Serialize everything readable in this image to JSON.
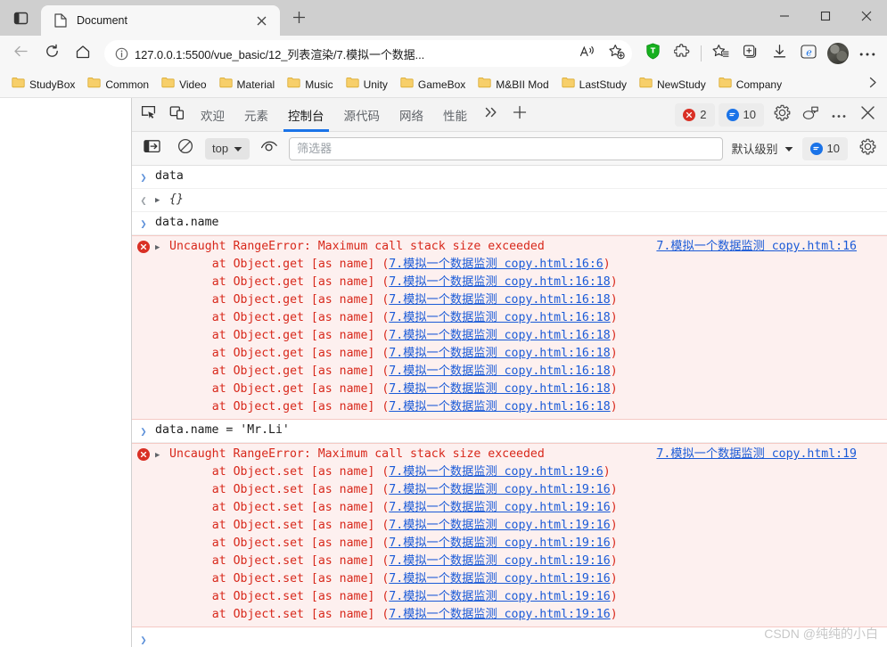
{
  "browser": {
    "tab": {
      "title": "Document",
      "favicon_icon": "page-icon",
      "close_icon": "close-icon"
    },
    "tabsearch_icon": "tab-search-icon",
    "newtab_icon": "plus-icon",
    "window_controls": {
      "minimize": "minimize-icon",
      "maximize": "maximize-icon",
      "close": "window-close-icon"
    },
    "nav": {
      "back_icon": "back-arrow-icon",
      "reload_icon": "reload-icon",
      "home_icon": "home-icon"
    },
    "omnibox": {
      "info_icon": "site-info-icon",
      "url_prefix": "127.0.0.1:5500",
      "url_rest": "/vue_basic/12_列表渲染/7.模拟一个数据...",
      "url_full": "127.0.0.1:5500/vue_basic/12_列表渲染/7.模拟一个数据...",
      "read_aloud_icon": "read-aloud-icon",
      "add_favorite_icon": "add-favorite-icon"
    },
    "toolbar_icons": [
      "green-shield-icon",
      "extensions-puzzle-icon",
      "favorites-icon",
      "collections-icon",
      "downloads-icon",
      "ie-mode-icon",
      "profile-avatar",
      "settings-more-icon"
    ],
    "bookmarks": [
      {
        "label": "StudyBox"
      },
      {
        "label": "Common"
      },
      {
        "label": "Video"
      },
      {
        "label": "Material"
      },
      {
        "label": "Music"
      },
      {
        "label": "Unity"
      },
      {
        "label": "GameBox"
      },
      {
        "label": "M&BII Mod"
      },
      {
        "label": "LastStudy"
      },
      {
        "label": "NewStudy"
      },
      {
        "label": "Company"
      }
    ],
    "bookmarks_overflow_icon": "chevron-right-icon"
  },
  "devtools": {
    "inspect_icon": "inspect-element-icon",
    "device_toolbar_icon": "device-toolbar-icon",
    "tabs": [
      {
        "label": "欢迎",
        "active": false
      },
      {
        "label": "元素",
        "active": false
      },
      {
        "label": "控制台",
        "active": true
      },
      {
        "label": "源代码",
        "active": false
      },
      {
        "label": "网络",
        "active": false
      },
      {
        "label": "性能",
        "active": false
      }
    ],
    "more_tabs_icon": "chevron-double-right-icon",
    "add_tab_icon": "plus-icon",
    "error_badge": {
      "count": "2",
      "icon": "error-circle-icon"
    },
    "message_badge": {
      "count": "10",
      "icon": "message-circle-icon"
    },
    "settings_icon": "gear-icon",
    "customize_icon": "devtools-dock-icon",
    "more_options_icon": "more-vertical-icon",
    "close_icon": "close-icon",
    "filterbar": {
      "sidebar_icon": "console-sidebar-icon",
      "clear_icon": "clear-console-icon",
      "context": "top",
      "context_chevron_icon": "chevron-down-icon",
      "eye_icon": "live-expression-eye-icon",
      "filter_placeholder": "筛选器",
      "filter_value": "",
      "level": "默认级别",
      "level_chevron_icon": "chevron-down-icon",
      "message_badge": {
        "count": "10",
        "icon": "message-circle-icon"
      },
      "settings_icon": "gear-icon"
    },
    "console_rows": [
      {
        "kind": "input",
        "prompt_icon": "chevron-right-icon",
        "text": "data"
      },
      {
        "kind": "output",
        "prompt_icon": "chevron-left-icon",
        "expander_icon": "triangle-right-icon",
        "text": "{}"
      },
      {
        "kind": "input",
        "prompt_icon": "chevron-right-icon",
        "text": "data.name"
      },
      {
        "kind": "error",
        "icon": "error-circle-icon",
        "expander_icon": "triangle-right-icon",
        "title": "Uncaught RangeError: Maximum call stack size exceeded",
        "source_link": "7.模拟一个数据监测 copy.html:16",
        "stack": [
          {
            "fn": "    at Object.get [as name] ",
            "link": "7.模拟一个数据监测 copy.html:16:6"
          },
          {
            "fn": "    at Object.get [as name] ",
            "link": "7.模拟一个数据监测 copy.html:16:18"
          },
          {
            "fn": "    at Object.get [as name] ",
            "link": "7.模拟一个数据监测 copy.html:16:18"
          },
          {
            "fn": "    at Object.get [as name] ",
            "link": "7.模拟一个数据监测 copy.html:16:18"
          },
          {
            "fn": "    at Object.get [as name] ",
            "link": "7.模拟一个数据监测 copy.html:16:18"
          },
          {
            "fn": "    at Object.get [as name] ",
            "link": "7.模拟一个数据监测 copy.html:16:18"
          },
          {
            "fn": "    at Object.get [as name] ",
            "link": "7.模拟一个数据监测 copy.html:16:18"
          },
          {
            "fn": "    at Object.get [as name] ",
            "link": "7.模拟一个数据监测 copy.html:16:18"
          },
          {
            "fn": "    at Object.get [as name] ",
            "link": "7.模拟一个数据监测 copy.html:16:18"
          }
        ]
      },
      {
        "kind": "input",
        "prompt_icon": "chevron-right-icon",
        "text": "data.name = 'Mr.Li'"
      },
      {
        "kind": "error",
        "icon": "error-circle-icon",
        "expander_icon": "triangle-right-icon",
        "title": "Uncaught RangeError: Maximum call stack size exceeded",
        "source_link": "7.模拟一个数据监测 copy.html:19",
        "stack": [
          {
            "fn": "    at Object.set [as name] ",
            "link": "7.模拟一个数据监测 copy.html:19:6"
          },
          {
            "fn": "    at Object.set [as name] ",
            "link": "7.模拟一个数据监测 copy.html:19:16"
          },
          {
            "fn": "    at Object.set [as name] ",
            "link": "7.模拟一个数据监测 copy.html:19:16"
          },
          {
            "fn": "    at Object.set [as name] ",
            "link": "7.模拟一个数据监测 copy.html:19:16"
          },
          {
            "fn": "    at Object.set [as name] ",
            "link": "7.模拟一个数据监测 copy.html:19:16"
          },
          {
            "fn": "    at Object.set [as name] ",
            "link": "7.模拟一个数据监测 copy.html:19:16"
          },
          {
            "fn": "    at Object.set [as name] ",
            "link": "7.模拟一个数据监测 copy.html:19:16"
          },
          {
            "fn": "    at Object.set [as name] ",
            "link": "7.模拟一个数据监测 copy.html:19:16"
          },
          {
            "fn": "    at Object.set [as name] ",
            "link": "7.模拟一个数据监测 copy.html:19:16"
          }
        ]
      }
    ],
    "prompt": {
      "icon": "chevron-right-icon",
      "value": ""
    }
  },
  "watermark": "CSDN @纯纯的小白",
  "colors": {
    "accent": "#1a73e8",
    "error_red": "#d93025",
    "error_text": "#d8281b",
    "error_bg": "#fdf0ef",
    "link_blue": "#1a5ad7",
    "chrome_gray": "#cfcfcf",
    "toolbar_gray": "#f7f7f7"
  }
}
